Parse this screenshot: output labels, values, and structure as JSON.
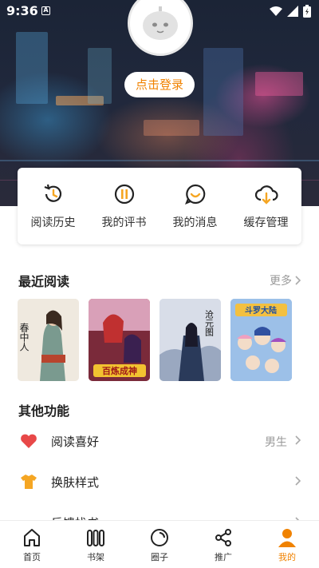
{
  "status": {
    "time": "9:36",
    "notif_letter": "A"
  },
  "profile": {
    "login_label": "点击登录"
  },
  "quick_actions": [
    {
      "label": "阅读历史",
      "icon": "history-icon"
    },
    {
      "label": "我的评书",
      "icon": "comment-book-icon"
    },
    {
      "label": "我的消息",
      "icon": "message-icon"
    },
    {
      "label": "缓存管理",
      "icon": "cloud-download-icon"
    }
  ],
  "recent": {
    "title": "最近阅读",
    "more_label": "更多",
    "covers": [
      {
        "title": "春中人",
        "bg": "#efe9df"
      },
      {
        "title": "百炼成神",
        "bg": "#b83a2e"
      },
      {
        "title": "沧元图",
        "bg": "#cfd6e4"
      },
      {
        "title": "斗罗大陆",
        "bg": "#7ea7d8"
      }
    ]
  },
  "other": {
    "title": "其他功能",
    "items": [
      {
        "label": "阅读喜好",
        "value": "男生",
        "icon": "heart-icon",
        "color": "#e84848"
      },
      {
        "label": "换肤样式",
        "value": "",
        "icon": "shirt-icon",
        "color": "#f5a623"
      },
      {
        "label": "反馈找书",
        "value": "",
        "icon": "feedback-icon",
        "color": "#4a78d8"
      }
    ]
  },
  "nav": [
    {
      "label": "首页",
      "icon": "home-icon"
    },
    {
      "label": "书架",
      "icon": "bookshelf-icon"
    },
    {
      "label": "圈子",
      "icon": "circle-icon"
    },
    {
      "label": "推广",
      "icon": "share-icon"
    },
    {
      "label": "我的",
      "icon": "profile-icon",
      "active": true
    }
  ],
  "colors": {
    "accent": "#f08200"
  }
}
